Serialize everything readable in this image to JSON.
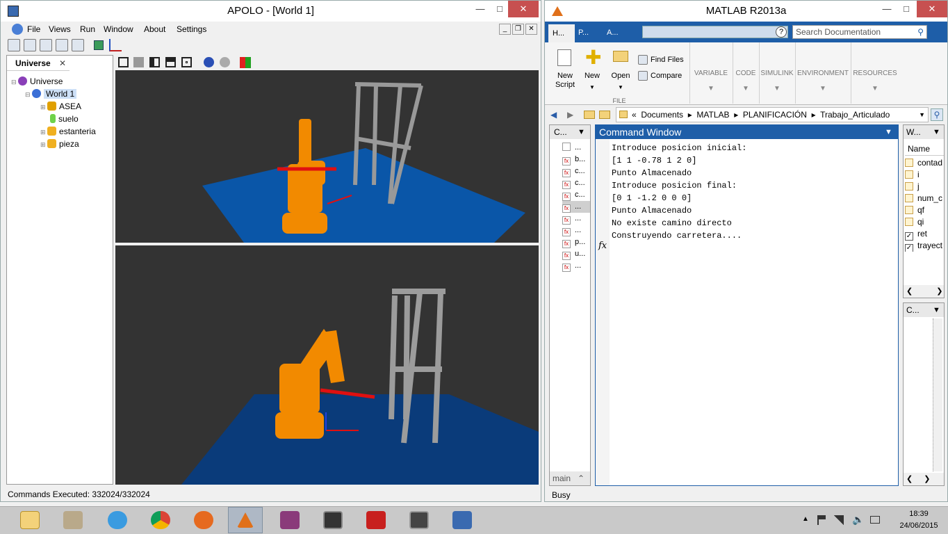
{
  "apolo": {
    "title": "APOLO - [World 1]",
    "menu": [
      "File",
      "Views",
      "Run",
      "Window",
      "About",
      "Settings"
    ],
    "universe_tab": "Universe",
    "tree": [
      {
        "label": "Universe",
        "level": 0,
        "color": "#8a3fb8"
      },
      {
        "label": "World 1",
        "level": 1,
        "color": "#3b6fd6",
        "selected": true
      },
      {
        "label": "ASEA",
        "level": 2,
        "color": "#e0a000"
      },
      {
        "label": "suelo",
        "level": 2,
        "color": "#6fd24a"
      },
      {
        "label": "estanteria",
        "level": 2,
        "color": "#f0b020"
      },
      {
        "label": "pieza",
        "level": 2,
        "color": "#f0b020"
      }
    ],
    "status": "Commands Executed: 332024/332024"
  },
  "matlab": {
    "title": "MATLAB R2013a",
    "tabs": [
      "H...",
      "P...",
      "A..."
    ],
    "search_placeholder": "Search Documentation",
    "ribbon": {
      "new_script": "New Script",
      "new": "New",
      "open": "Open",
      "find_files": "Find Files",
      "compare": "Compare",
      "file_group": "FILE",
      "groups": [
        "VARIABLE",
        "CODE",
        "SIMULINK",
        "ENVIRONMENT",
        "RESOURCES"
      ]
    },
    "path": [
      "Documents",
      "MATLAB",
      "PLANIFICACIÓN",
      "Trabajo_Articulado"
    ],
    "current_folder_title": "C...",
    "files": [
      "...",
      "b...",
      "c...",
      "c...",
      "c...",
      "...",
      "...",
      "...",
      "p...",
      "u...",
      "..."
    ],
    "folder_footer": "main",
    "command_window_title": "Command Window",
    "command_lines": [
      "Introduce posicion inicial:",
      "[1 1 -0.78 1 2 0]",
      "Punto Almacenado",
      "Introduce posicion final:",
      "[0 1 -1.2 0 0 0]",
      "Punto Almacenado",
      "No existe camino directo",
      "Construyendo carretera...."
    ],
    "fx": "fx",
    "workspace_title": "W...",
    "workspace_header": "Name",
    "workspace_vars": [
      "contad",
      "i",
      "j",
      "num_c",
      "qf",
      "qi",
      "ret",
      "trayect"
    ],
    "history_title": "C...",
    "status": "Busy"
  },
  "taskbar": {
    "time": "18:39",
    "date": "24/06/2015"
  }
}
